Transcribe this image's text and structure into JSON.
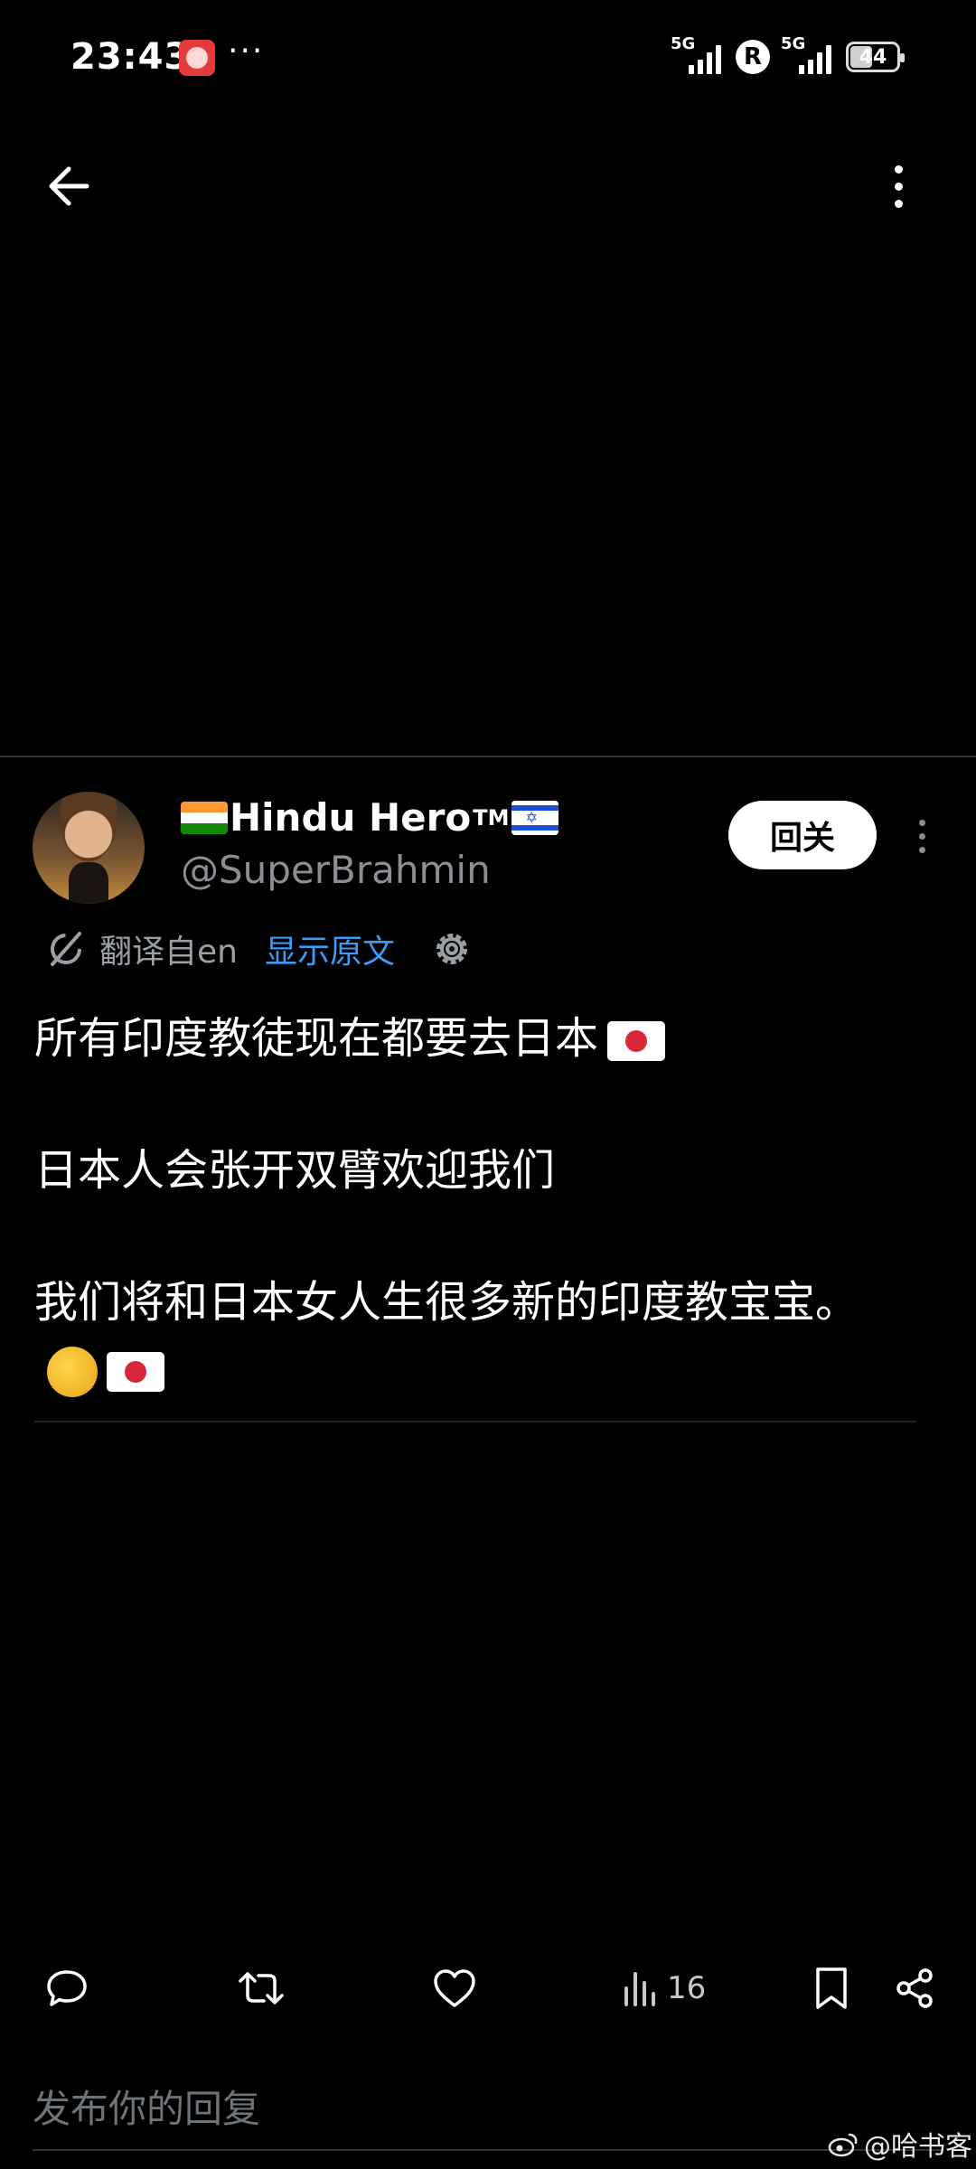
{
  "status_bar": {
    "time": "23:43",
    "more": "···",
    "net1": "5G",
    "net2": "5G",
    "roaming": "R",
    "battery": "44"
  },
  "author": {
    "name": "Hindu Hero",
    "tm": "TM",
    "handle": "@SuperBrahmin",
    "follow_label": "回关"
  },
  "translation": {
    "label": "翻译自en",
    "show_original": "显示原文"
  },
  "tweet": {
    "line1": "所有印度教徒现在都要去日本",
    "line2": "日本人会张开双臂欢迎我们",
    "line3": "我们将和日本女人生很多新的印度教宝宝。"
  },
  "actions": {
    "views": "16"
  },
  "reply": {
    "placeholder": "发布你的回复"
  },
  "watermark": "@哈书客",
  "colors": {
    "background": "#000000",
    "link": "#3b9af4",
    "muted": "#8b8f94"
  },
  "icons": [
    "back-arrow-icon",
    "more-vertical-icon",
    "translate-icon",
    "gear-icon",
    "reply-icon",
    "retweet-icon",
    "like-icon",
    "views-icon",
    "bookmark-icon",
    "share-icon",
    "weibo-icon"
  ]
}
